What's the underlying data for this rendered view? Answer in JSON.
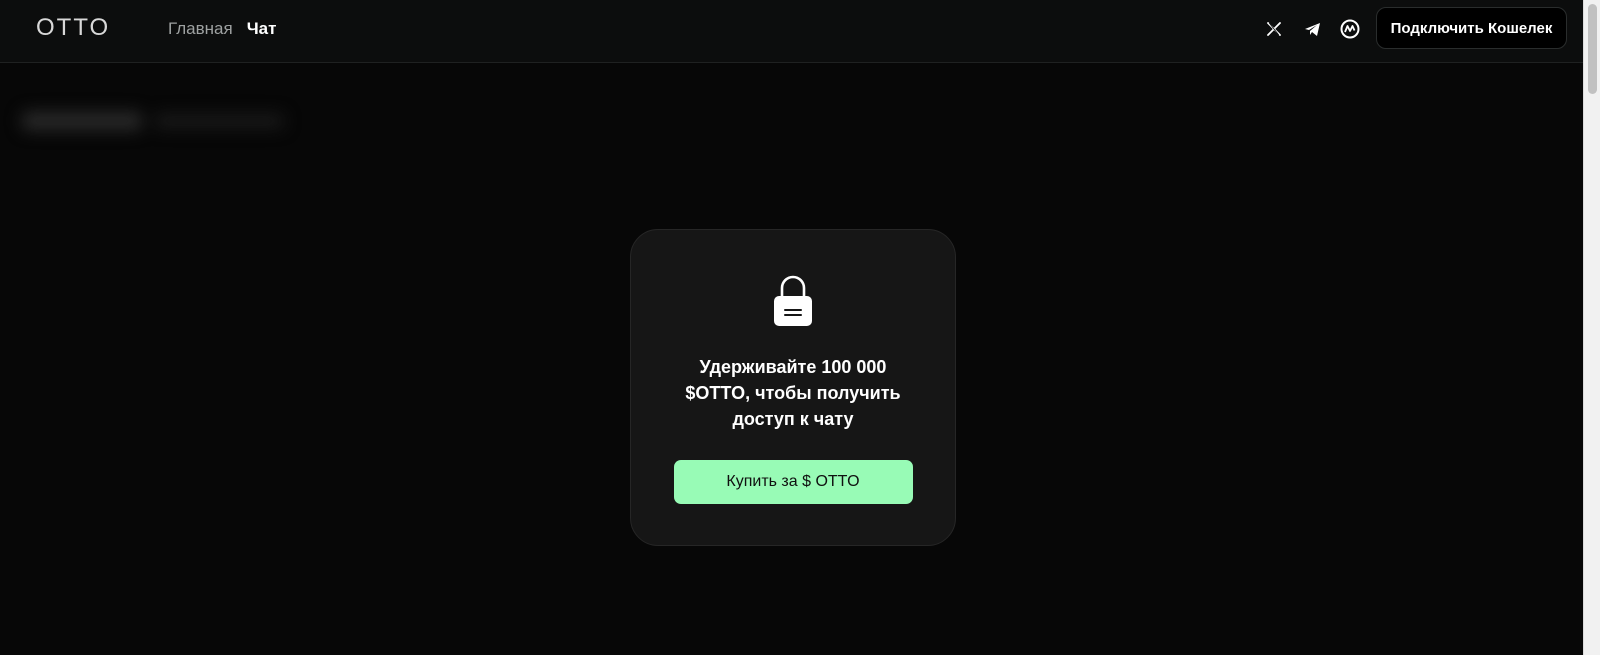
{
  "header": {
    "logo": "OTTO",
    "nav": [
      {
        "label": "Главная"
      },
      {
        "label": "Чат"
      }
    ],
    "socials": [
      {
        "icon": "x-icon"
      },
      {
        "icon": "telegram-icon"
      },
      {
        "icon": "coinmarketcap-icon"
      }
    ],
    "connect_label": "Подключить Кошелек"
  },
  "modal": {
    "icon": "lock-icon",
    "message": "Удерживайте 100 000 $OTTO, чтобы получить доступ к чату",
    "buy_label": "Купить за $ OTTO",
    "accent_color": "#98fbb6"
  }
}
